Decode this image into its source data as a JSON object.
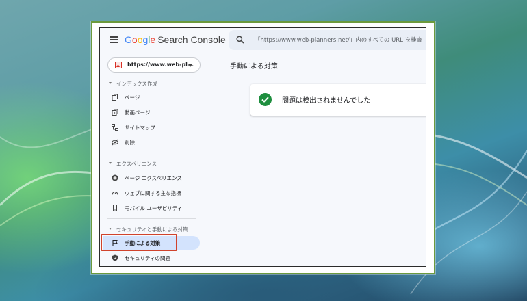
{
  "header": {
    "menu_icon": "hamburger-icon",
    "logo_google": [
      "G",
      "o",
      "o",
      "g",
      "l",
      "e"
    ],
    "logo_product": "Search Console",
    "search_icon": "search-icon",
    "search_placeholder": "「https://www.web-planners.net/」内のすべての URL を検査"
  },
  "sidebar": {
    "property": {
      "label": "https://www.web-pl...",
      "icon": "site-favicon-icon",
      "caret_icon": "caret-down-icon"
    },
    "sections": [
      {
        "title": "インデックス作成",
        "items": [
          {
            "label": "ページ",
            "icon": "pages-icon"
          },
          {
            "label": "動画ページ",
            "icon": "video-pages-icon"
          },
          {
            "label": "サイトマップ",
            "icon": "sitemap-icon"
          },
          {
            "label": "削除",
            "icon": "removals-icon"
          }
        ]
      },
      {
        "title": "エクスペリエンス",
        "items": [
          {
            "label": "ページ エクスペリエンス",
            "icon": "page-experience-icon"
          },
          {
            "label": "ウェブに関する主な指標",
            "icon": "gauge-icon"
          },
          {
            "label": "モバイル ユーザビリティ",
            "icon": "mobile-icon"
          }
        ]
      },
      {
        "title": "セキュリティと手動による対策",
        "items": [
          {
            "label": "手動による対策",
            "icon": "flag-icon",
            "active": true
          },
          {
            "label": "セキュリティの問題",
            "icon": "shield-icon"
          }
        ]
      }
    ]
  },
  "main": {
    "title": "手動による対策",
    "status_icon": "check-circle-icon",
    "status_text": "問題は検出されませんでした"
  },
  "colors": {
    "active_bg": "#d3e3fd",
    "highlight_border": "#d0432c",
    "success_green": "#1e8e3e",
    "frame_border": "#6c9a3d"
  }
}
